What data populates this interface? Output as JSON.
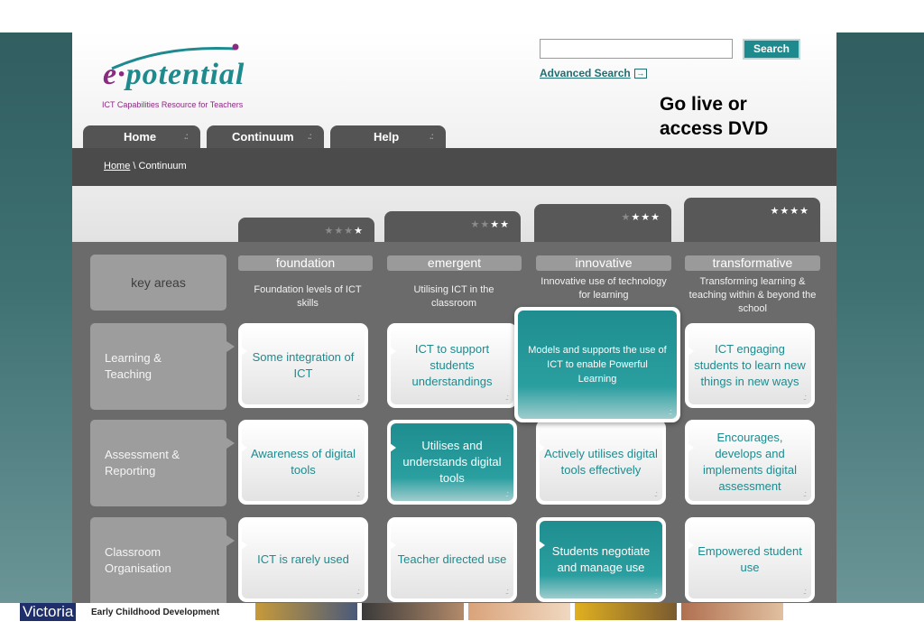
{
  "header": {
    "logo_text": "e·potential",
    "tagline": "ICT Capabilities Resource for Teachers",
    "search_button": "Search",
    "search_placeholder": "",
    "advanced_search": "Advanced Search",
    "note_line1": "Go live or",
    "note_line2": "access DVD"
  },
  "nav": {
    "tabs": [
      {
        "label": "Home"
      },
      {
        "label": "Continuum"
      },
      {
        "label": "Help"
      }
    ],
    "grip": ".:"
  },
  "breadcrumb": {
    "home": "Home",
    "separator": " \\ ",
    "current": "Continuum"
  },
  "continuum": {
    "key_areas_label": "key areas",
    "stages": [
      {
        "name": "foundation",
        "desc": "Foundation levels of ICT skills",
        "stars_lit": 1
      },
      {
        "name": "emergent",
        "desc": "Utilising ICT in the classroom",
        "stars_lit": 2
      },
      {
        "name": "innovative",
        "desc": "Innovative use of technology for learning",
        "stars_lit": 3
      },
      {
        "name": "transformative",
        "desc": "Transforming learning & teaching within & beyond the school",
        "stars_lit": 4
      }
    ],
    "rows": [
      {
        "label_line1": "Learning &",
        "label_line2": "Teaching",
        "cells": [
          "Some integration of ICT",
          "ICT to support students understandings",
          "Models and supports the use of ICT to enable Powerful Learning",
          "ICT engaging students to learn new things in new ways"
        ]
      },
      {
        "label_line1": "Assessment &",
        "label_line2": "Reporting",
        "cells": [
          "Awareness of digital tools",
          "Utilises and understands digital tools",
          "Actively utilises digital tools effectively",
          "Encourages, develops and implements digital assessment"
        ]
      },
      {
        "label_line1": "Classroom",
        "label_line2": "Organisation",
        "cells": [
          "ICT is rarely used",
          "Teacher directed use",
          "Students negotiate and manage use",
          "Empowered student use"
        ]
      }
    ]
  },
  "footer": {
    "state": "Victoria",
    "department": "Early Childhood Development"
  },
  "colors": {
    "teal": "#1e8a8e",
    "purple": "#8a2a80",
    "dark_grey": "#4b4b4b"
  }
}
